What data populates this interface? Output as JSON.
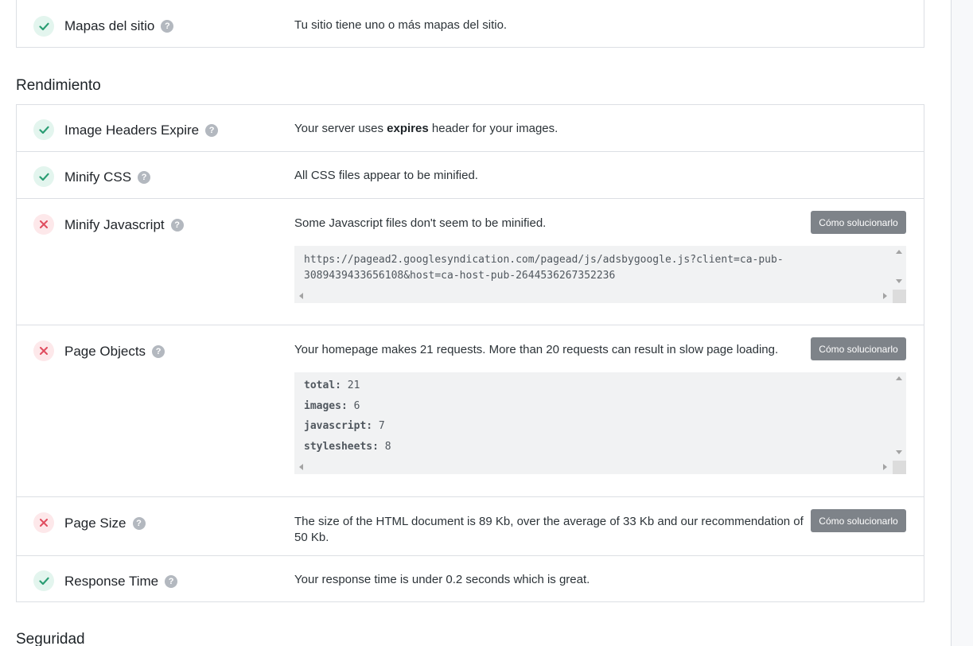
{
  "sitemaps": {
    "label": "Mapas del sitio",
    "status": "pass",
    "description": "Tu sitio tiene uno o más mapas del sitio."
  },
  "performance": {
    "title": "Rendimiento",
    "checks": [
      {
        "label": "Image Headers Expire",
        "status": "pass",
        "desc_before": "Your server uses ",
        "desc_bold": "expires",
        "desc_after": " header for your images."
      },
      {
        "label": "Minify CSS",
        "status": "pass",
        "description": "All CSS files appear to be minified."
      },
      {
        "label": "Minify Javascript",
        "status": "fail",
        "description": "Some Javascript files don't seem to be minified.",
        "fix_label": "Cómo solucionarlo",
        "code_lines": [
          "https://pagead2.googlesyndication.com/pagead/js/adsbygoogle.js?client=ca-pub-",
          "3089439433656108&host=ca-host-pub-2644536267352236"
        ]
      },
      {
        "label": "Page Objects",
        "status": "fail",
        "description": "Your homepage makes 21 requests. More than 20 requests can result in slow page loading.",
        "fix_label": "Cómo solucionarlo",
        "stats": [
          {
            "key": "total:",
            "value": "21"
          },
          {
            "key": "images:",
            "value": "6"
          },
          {
            "key": "javascript:",
            "value": "7"
          },
          {
            "key": "stylesheets:",
            "value": "8"
          }
        ]
      },
      {
        "label": "Page Size",
        "status": "fail",
        "description": "The size of the HTML document is 89 Kb, over the average of 33 Kb and our recommendation of 50 Kb.",
        "fix_label": "Cómo solucionarlo"
      },
      {
        "label": "Response Time",
        "status": "pass",
        "description": "Your response time is under 0.2 seconds which is great."
      }
    ]
  },
  "security": {
    "title": "Seguridad"
  },
  "help_glyph": "?",
  "icons": {
    "pass": "check-icon",
    "fail": "cross-icon",
    "help": "question-mark-icon"
  },
  "colors": {
    "pass_icon": "#2a9d73",
    "pass_bg": "#e3f5ee",
    "fail_icon": "#e04d5f",
    "fail_bg": "#fde8ea",
    "button_bg": "#7e8389"
  }
}
